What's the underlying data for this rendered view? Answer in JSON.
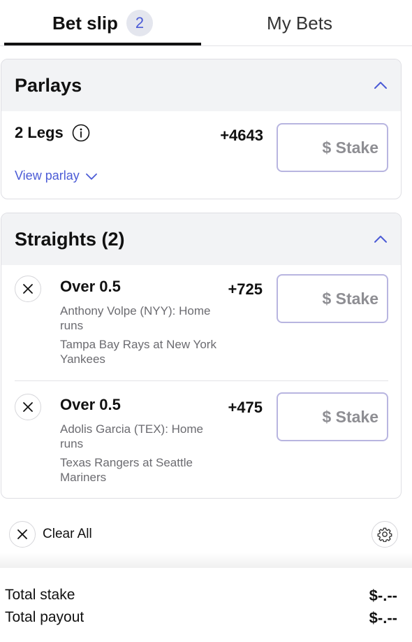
{
  "tabs": {
    "bet_slip_label": "Bet slip",
    "bet_slip_count": "2",
    "my_bets_label": "My Bets"
  },
  "parlays": {
    "title": "Parlays",
    "legs_label": "2 Legs",
    "odds": "+4643",
    "stake_placeholder": "$ Stake",
    "view_parlay_label": "View parlay"
  },
  "straights": {
    "title": "Straights (2)",
    "bets": [
      {
        "selection": "Over 0.5",
        "odds": "+725",
        "market": "Anthony Volpe (NYY): Home runs",
        "event": "Tampa Bay Rays at New York Yankees",
        "stake_placeholder": "$ Stake"
      },
      {
        "selection": "Over 0.5",
        "odds": "+475",
        "market": "Adolis Garcia (TEX): Home runs",
        "event": "Texas Rangers at Seattle Mariners",
        "stake_placeholder": "$ Stake"
      }
    ]
  },
  "actions": {
    "clear_all_label": "Clear All"
  },
  "totals": {
    "stake_label": "Total stake",
    "stake_value": "$-.--",
    "payout_label": "Total payout",
    "payout_value": "$-.--"
  },
  "icons": {
    "collapse": "chevron-up-icon",
    "info": "info-icon",
    "expand": "chevron-down-icon",
    "remove": "close-icon",
    "settings": "gear-icon"
  },
  "colors": {
    "accent": "#4b5bd6",
    "stake_border": "#b8b5e0",
    "header_bg": "#f2f3f5"
  }
}
